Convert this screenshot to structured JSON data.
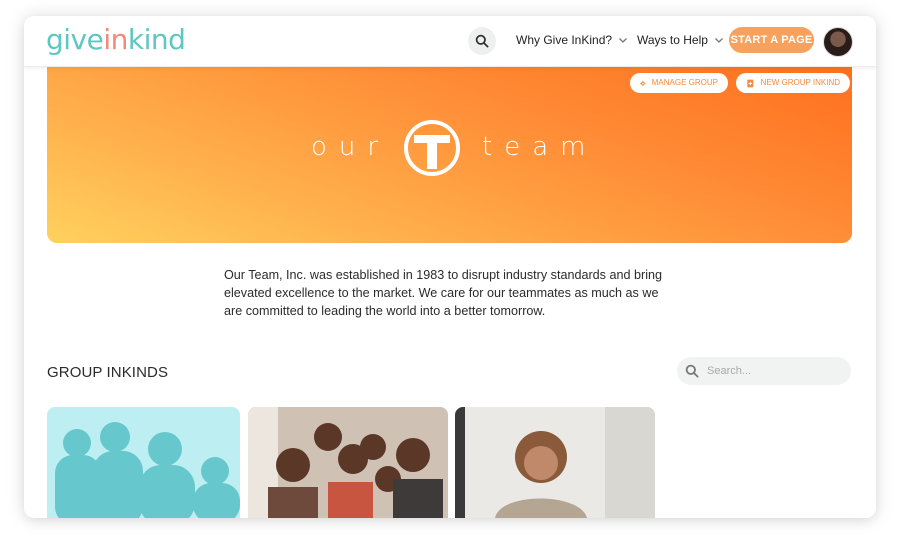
{
  "header": {
    "logo_text_a": "give",
    "logo_text_b": "in",
    "logo_text_c": "kind",
    "nav": [
      {
        "label": "Why Give InKind?"
      },
      {
        "label": "Ways to Help"
      }
    ],
    "cta_label": "START A PAGE"
  },
  "hero": {
    "manage_label": "MANAGE GROUP",
    "new_label": "NEW GROUP INKIND",
    "word_left": "our",
    "word_right": "team",
    "gradient_colors": [
      "#ff6f1f",
      "#ffd15e"
    ]
  },
  "description": "Our Team, Inc. was established in 1983 to disrupt industry standards and bring elevated excellence to the market. We care for our teammates as much as we are committed to leading the world into a better tomorrow.",
  "section": {
    "title": "GROUP INKINDS",
    "search_placeholder": "Search..."
  },
  "colors": {
    "brand_teal": "#5fc7c1",
    "accent_orange": "#f7a15e"
  },
  "icons": [
    "search-icon",
    "chevron-down-icon",
    "gear-icon",
    "document-plus-icon"
  ]
}
